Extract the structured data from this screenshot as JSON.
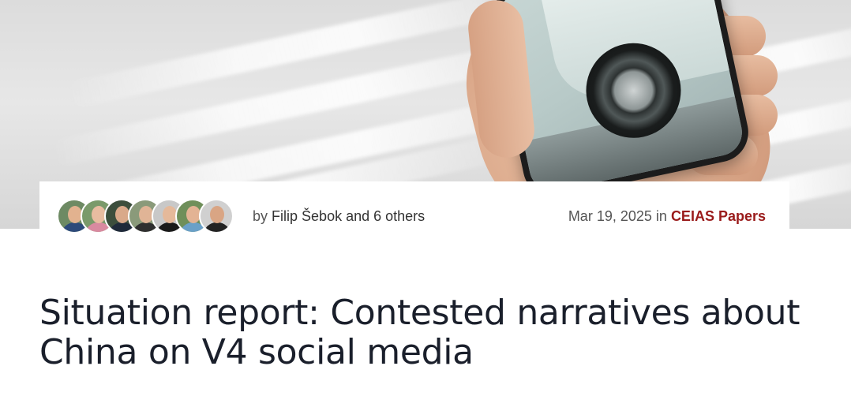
{
  "byline": {
    "prefix": "by",
    "author": "Filip Šebok",
    "others": "and 6 others"
  },
  "meta": {
    "date": "Mar 19, 2025",
    "in_word": "in",
    "category": "CEIAS Papers"
  },
  "avatars": [
    {
      "name": "author-avatar-1",
      "bg": "#6d8a63",
      "face": "#e2b28f",
      "torso": "#2d4a7a"
    },
    {
      "name": "author-avatar-2",
      "bg": "#7a9a6a",
      "face": "#e8bca0",
      "torso": "#d98aa0"
    },
    {
      "name": "author-avatar-3",
      "bg": "#3c4e3c",
      "face": "#d9a98a",
      "torso": "#1f2a3a"
    },
    {
      "name": "author-avatar-4",
      "bg": "#8a9a7a",
      "face": "#e0b496",
      "torso": "#2f2f2f"
    },
    {
      "name": "author-avatar-5",
      "bg": "#c8c8c8",
      "face": "#e5b99a",
      "torso": "#1a1a1a"
    },
    {
      "name": "author-avatar-6",
      "bg": "#6f8f5a",
      "face": "#e3b394",
      "torso": "#6aa0c8"
    },
    {
      "name": "author-avatar-7",
      "bg": "#d0d0d0",
      "face": "#d9a584",
      "torso": "#222222"
    }
  ],
  "article": {
    "title_line1": "Situation report: Contested narratives about",
    "title_line2": "China on V4 social media"
  },
  "colors": {
    "category_accent": "#9a1b1b",
    "title_text": "#1a1f2b"
  }
}
